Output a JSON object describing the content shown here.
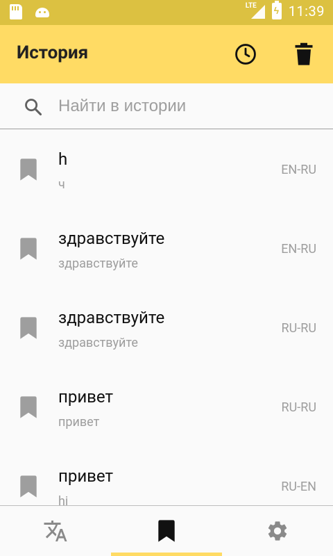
{
  "status_bar": {
    "network": "LTE",
    "time": "11:39"
  },
  "app_bar": {
    "title": "История",
    "history_icon": "clock-icon",
    "delete_icon": "trash-icon"
  },
  "search": {
    "placeholder": "Найти в истории",
    "value": ""
  },
  "history": [
    {
      "word": "h",
      "translation": "ч",
      "lang": "EN-RU"
    },
    {
      "word": "здравствуйте",
      "translation": "здравствуйте",
      "lang": "EN-RU"
    },
    {
      "word": "здравствуйте",
      "translation": "здравствуйте",
      "lang": "RU-RU"
    },
    {
      "word": "привет",
      "translation": "привет",
      "lang": "RU-RU"
    },
    {
      "word": "привет",
      "translation": "hi",
      "lang": "RU-EN"
    }
  ],
  "bottom_nav": {
    "tabs": [
      {
        "icon": "translate-icon",
        "active": false
      },
      {
        "icon": "bookmark-icon",
        "active": true
      },
      {
        "icon": "gear-icon",
        "active": false
      }
    ]
  },
  "colors": {
    "accent": "#ffdb64",
    "status_bar": "#dcc141",
    "secondary_text": "#9e9e9e",
    "bookmark_icon": "#9e9e9e"
  }
}
